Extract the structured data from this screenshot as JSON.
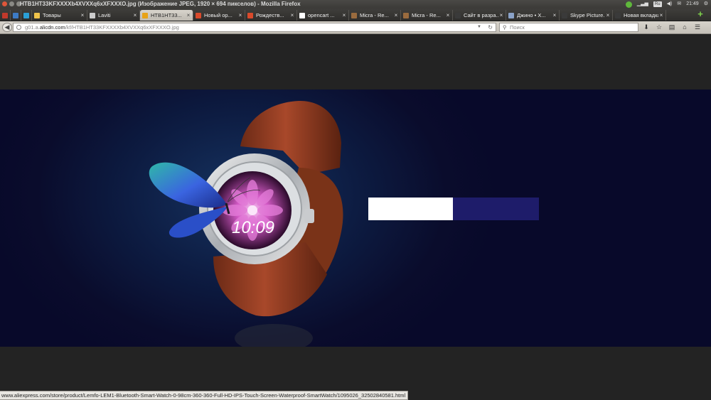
{
  "window": {
    "title": "HTB1HT33KFXXXXb4XVXXq6xXFXXXO.jpg (Изображение JPEG, 1920 × 694 пикселов) - Mozilla Firefox"
  },
  "tray": {
    "lang": "Ru",
    "time": "21:49"
  },
  "tabs": [
    {
      "label": "",
      "color": "#c0392b",
      "pinned": true
    },
    {
      "label": "",
      "color": "#3d7bc4",
      "pinned": true
    },
    {
      "label": "",
      "color": "#2a9fd6",
      "pinned": true
    },
    {
      "label": "Товары",
      "color": "#f0c34a"
    },
    {
      "label": "Laviti",
      "color": "#cccccc"
    },
    {
      "label": "HTB1HT33...",
      "color": "#e8a317",
      "active": true
    },
    {
      "label": "Новый ор...",
      "color": "#d94a2b"
    },
    {
      "label": "Рождеств...",
      "color": "#d94a2b"
    },
    {
      "label": "opencart ...",
      "color": "#ffffff"
    },
    {
      "label": "Micra - Re...",
      "color": "#9a6b3e"
    },
    {
      "label": "Micra - Re...",
      "color": "#9a6b3e"
    },
    {
      "label": "Сайт в разра...",
      "color": "#3a3a3a"
    },
    {
      "label": "Джино • Х...",
      "color": "#8aa2c8"
    },
    {
      "label": "Skype Picture...",
      "color": "#3a3a3a"
    },
    {
      "label": "Новая вкладка",
      "color": "#3a3a3a"
    }
  ],
  "nav": {
    "url_prefix": "g01.a.",
    "url_domain": "alicdn.com",
    "url_path": "/kf/HTB1HT33KFXXXXb4XVXXq6xXFXXXO.jpg",
    "search_placeholder": "Поиск"
  },
  "image": {
    "watch_time": "10:09"
  },
  "status_bar": {
    "text": "www.aliexpress.com/store/product/Lemfo-LEM1-Bluetooth-Smart-Watch-0-98cm-360-360-Full-HD-IPS-Touch-Screen-Waterproof-SmartWatch/1095026_32502840581.html"
  },
  "colors": {
    "banner_white": "#ffffff",
    "banner_navy": "#1e1c6a",
    "viewer_bg": "#232323"
  }
}
